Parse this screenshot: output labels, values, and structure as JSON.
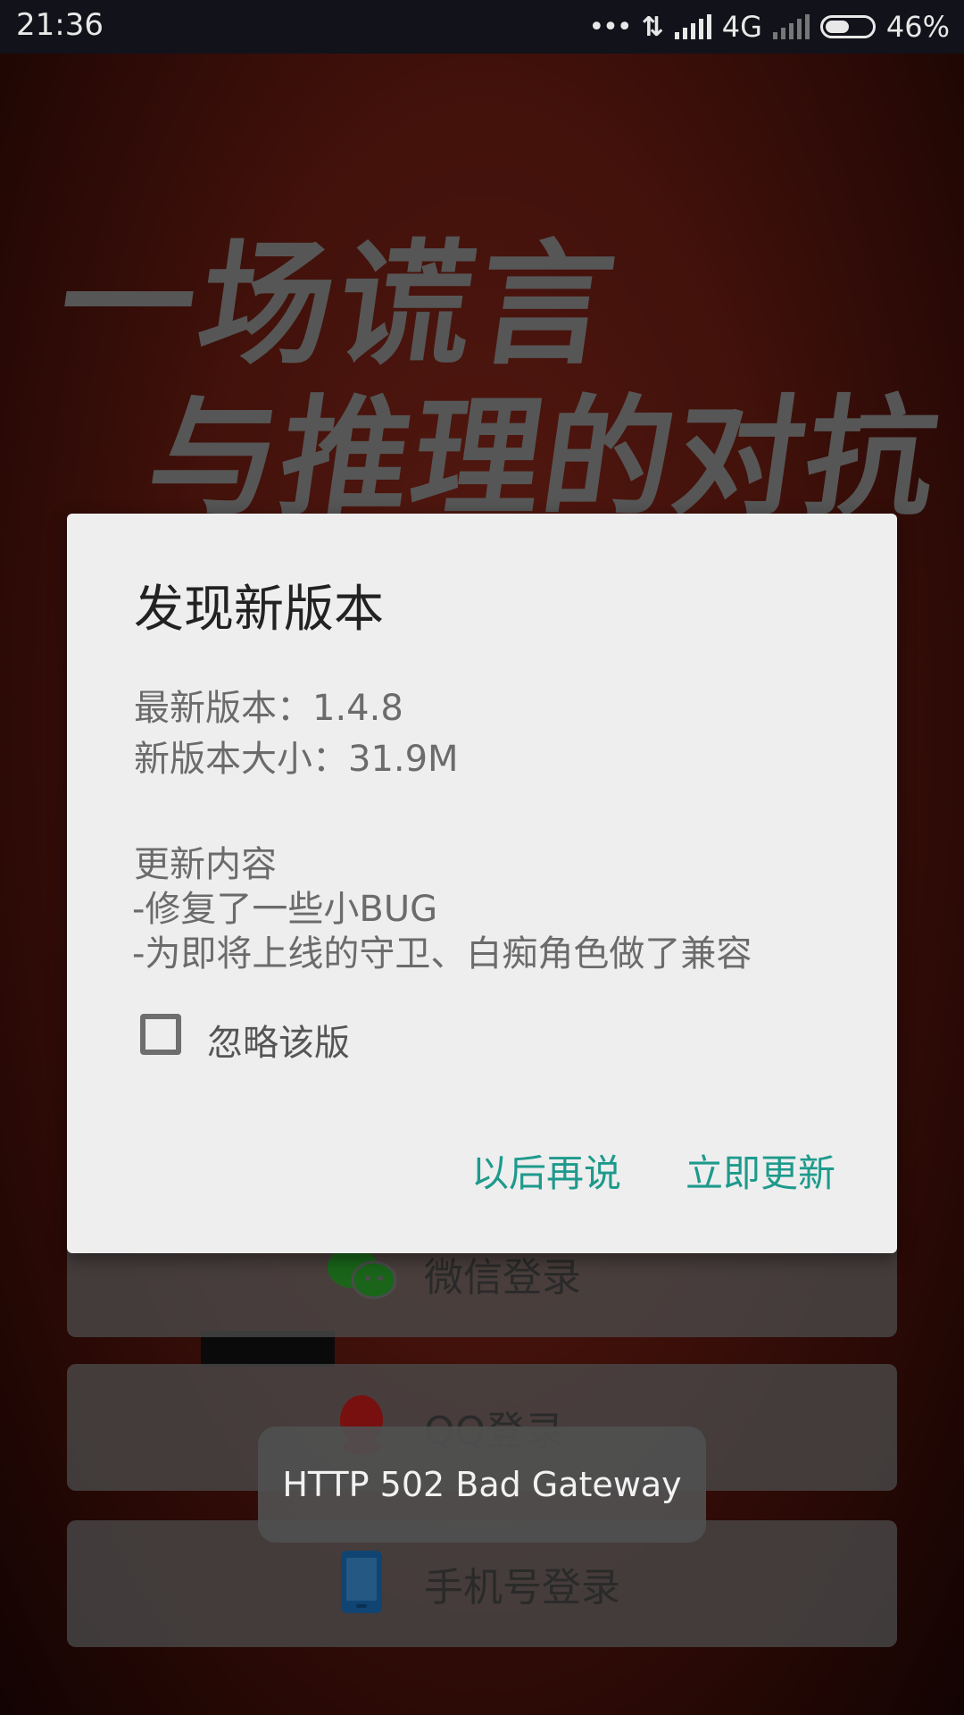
{
  "status_bar": {
    "time": "21:36",
    "network": "4G",
    "battery": "46%",
    "battery_level": 0.46
  },
  "background": {
    "slogan_line1": "一场谎言",
    "slogan_line2": "与推理的对抗"
  },
  "login_buttons": {
    "wechat": "微信登录",
    "qq": "QQ登录",
    "phone": "手机号登录"
  },
  "dialog": {
    "title": "发现新版本",
    "latest_version": "最新版本：1.4.8",
    "new_size": "新版本大小：31.9M",
    "notes_heading": "更新内容",
    "notes": [
      "-修复了一些小BUG",
      "-为即将上线的守卫、白痴角色做了兼容"
    ],
    "ignore_label": "忽略该版",
    "ignore_checked": false,
    "later_button": "以后再说",
    "update_button": "立即更新"
  },
  "toast": {
    "text": "HTTP 502 Bad Gateway"
  },
  "colors": {
    "accent": "#1e9a8c",
    "wechat": "#2aa32a",
    "qq": "#c41a1a",
    "phone": "#1a6fb8"
  }
}
